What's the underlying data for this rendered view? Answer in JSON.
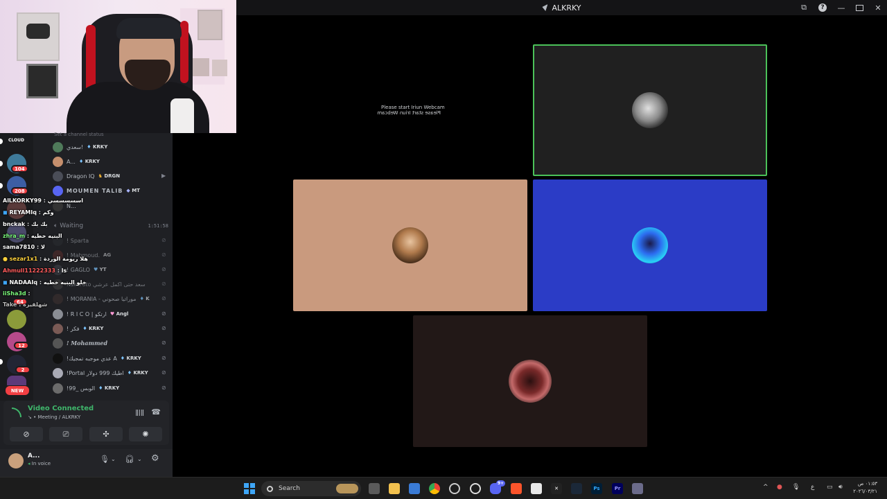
{
  "window": {
    "title": "ALKRKY"
  },
  "sidebar": {
    "channel_status_hint": "Set a channel status",
    "cloud_label": "CLOUD",
    "guild_badges": [
      "104",
      "208",
      "64",
      "12",
      "2"
    ],
    "new_badge": "NEW",
    "voice_users": [
      {
        "name": "سعدي!",
        "tag": "KRKY",
        "color": "#4f7a5a"
      },
      {
        "name": "A...",
        "tag": "KRKY",
        "color": "#c58f6d"
      },
      {
        "name": "Dragon IQ",
        "tag": "DRGN",
        "color": "#4a4d57"
      },
      {
        "name": "MOUMEN TALIB",
        "tag": "MT",
        "color": "#5865f2"
      },
      {
        "name": "N...",
        "tag": "",
        "color": "#333"
      }
    ],
    "waiting_label": "Waiting",
    "waiting_time": "1:51:58",
    "waiting_users": [
      {
        "name": "! Sparta",
        "tag": "",
        "color": "#2b2d31"
      },
      {
        "name": "! Mahmoud.",
        "tag": "AG",
        "color": "#5a2d2d"
      },
      {
        "name": "! GAGLO",
        "tag": "YT",
        "color": "#3b3d44"
      },
      {
        "name": "Kakaroto سعد حتى اكمل عرشي",
        "tag": "",
        "color": "#444"
      },
      {
        "name": "! MORANIA - موراتيا صحوني",
        "tag": "K",
        "color": "#3a2f2f"
      },
      {
        "name": "! R I C O | ارتكو",
        "tag": "Angl",
        "color": "#8a8d94"
      },
      {
        "name": "! فكر",
        "tag": "KRKY",
        "color": "#7a5a55"
      },
      {
        "name": "! 𝑴𝒐𝒉𝒂𝒎𝒎𝒆𝒅",
        "tag": "",
        "color": "#555"
      },
      {
        "name": "!عدي موجبه تمجيك A",
        "tag": "KRKY",
        "color": "#111"
      },
      {
        "name": "!Portal اطيك 999 دولار",
        "tag": "KRKY",
        "color": "#a9aab5"
      },
      {
        "name": "!99_ الوبس",
        "tag": "KRKY",
        "color": "#6b6b6b"
      }
    ]
  },
  "chat": [
    {
      "user": "AlLKORKY99",
      "msg": "اسسسسسي",
      "ucolor": "#ffffff"
    },
    {
      "user": "REYAMIq",
      "msg": "وكم",
      "ucolor": "#ffffff"
    },
    {
      "user": "bnckak",
      "msg": "بك بك",
      "ucolor": "#ffffff"
    },
    {
      "user": "zhra_m",
      "msg": "البنيه خطيه",
      "ucolor": "#7cfc7c"
    },
    {
      "user": "sama7810",
      "msg": "لا",
      "ucolor": "#ffffff"
    },
    {
      "user": "sezar1x1",
      "msg": "هلا ريومة الوردة",
      "ucolor": "#ffd23c"
    },
    {
      "user": "Ahmull11222333",
      "msg": "ls",
      "ucolor": "#ff5c5c"
    },
    {
      "user": "NADAAIq",
      "msg": "خلو البنيه خطيه",
      "ucolor": "#ffffff"
    },
    {
      "user": "iiSha3d",
      "msg": "",
      "ucolor": "#7cfc7c"
    },
    {
      "user": "Take",
      "msg": "شهلقيره",
      "ucolor": "#bbbbbb"
    }
  ],
  "voice": {
    "status": "Video Connected",
    "channel": "Meeting / ALKRKY"
  },
  "user": {
    "name": "A...",
    "status": "In voice"
  },
  "stage": {
    "iriun_line": "Please start Iriun Webcam",
    "iriun_mirror": "Please start Iriun Webcam"
  },
  "taskbar": {
    "search": "Search",
    "discord_badge": "9+",
    "lang": "ع",
    "time": "٠١:٥٣ ص",
    "date": "٢٠٢٦/٠٣/٢١"
  },
  "colors": {
    "tile_tan": "#c99a7e",
    "tile_blue": "#2b3cc6",
    "tile_dark": "#221817",
    "tile_gray": "#202020",
    "speaking_border": "#4bc259"
  }
}
